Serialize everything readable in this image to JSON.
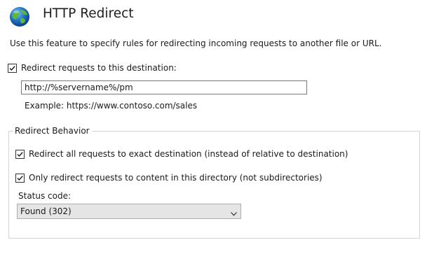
{
  "header": {
    "title": "HTTP Redirect",
    "icon": "globe-icon"
  },
  "description": "Use this feature to specify rules for redirecting incoming requests to another file or URL.",
  "redirect": {
    "checkbox_label": "Redirect requests to this destination:",
    "checked": true,
    "destination_value": "http://%servername%/pm",
    "example": "Example: https://www.contoso.com/sales"
  },
  "behavior": {
    "group_label": "Redirect Behavior",
    "exact_destination_label": "Redirect all requests to exact destination (instead of relative to destination)",
    "exact_destination_checked": true,
    "only_this_directory_label": "Only redirect requests to content in this directory (not subdirectories)",
    "only_this_directory_checked": true,
    "status_code_label": "Status code:",
    "status_code_value": "Found (302)"
  },
  "colors": {
    "globe_blue": "#1f6fc5",
    "globe_green": "#5cb83a",
    "dropdown_bg": "#e5e5e5"
  }
}
